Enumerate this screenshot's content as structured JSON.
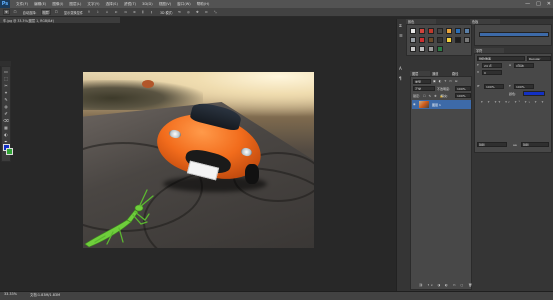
{
  "app": {
    "logo": "Ps",
    "menu": [
      "文件(F)",
      "编辑(E)",
      "图像(I)",
      "图层(L)",
      "文字(Y)",
      "选择(S)",
      "滤镜(T)",
      "3D(D)",
      "视图(V)",
      "窗口(W)",
      "帮助(H)"
    ],
    "window_controls": [
      "—",
      "□",
      "✕"
    ]
  },
  "options_bar": {
    "auto_select_label": "自动选择:",
    "auto_select_value": "图层",
    "transform_label": "显示变换控件",
    "mode_label": "3D 模式:"
  },
  "document": {
    "tab_title": "车.jpg @ 33.3%(图层 1, RGB/8#)"
  },
  "tools": [
    "▭",
    "⬚",
    "✂",
    "⌖",
    "✎",
    "◍",
    "✐",
    "⌫",
    "▦",
    "◐",
    "✒",
    "T",
    "↖",
    "▭",
    "✋",
    "🔍"
  ],
  "colors": {
    "foreground": "#1230c4",
    "background": "#31a336",
    "accent_blue": "#2a6fb8"
  },
  "right_panels": {
    "top_tabs": [
      "颜色",
      "色板"
    ],
    "properties_tab": "字符",
    "font_value": "微软雅黑",
    "font_style_value": "Regular",
    "size_value": "24 点",
    "leading_value": "(自动)",
    "tracking_value": "0",
    "scale_value": "100%",
    "color_label": "颜色:",
    "layers_tabs": [
      "图层",
      "通道",
      "路径"
    ],
    "kind_label": "类型",
    "blend_mode": "正常",
    "opacity_label": "不透明度:",
    "opacity_value": "100%",
    "lock_label": "锁定:",
    "fill_label": "填充:",
    "fill_value": "100%",
    "layer_name": "图层 1",
    "bottom_value": "锐利",
    "aa_value": "aa"
  },
  "status": {
    "zoom": "33.33%",
    "doc_info": "文档:1.83M/1.83M"
  }
}
